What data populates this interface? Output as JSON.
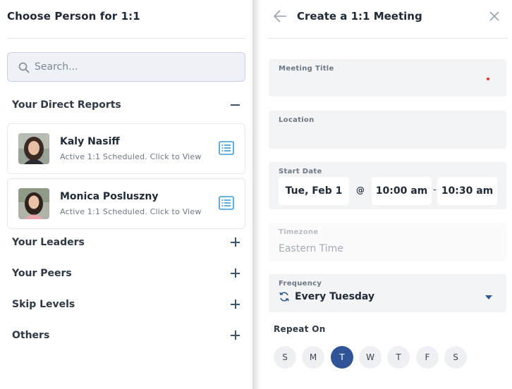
{
  "left": {
    "title": "Choose Person for 1:1",
    "search_placeholder": "Search...",
    "direct_reports_label": "Your Direct Reports",
    "people": [
      {
        "name": "Kaly Nasiff",
        "status": "Active 1:1 Scheduled. Click to View"
      },
      {
        "name": "Monica Posluszny",
        "status": "Active 1:1 Scheduled. Click to View"
      }
    ],
    "sections": [
      "Your Leaders",
      "Your Peers",
      "Skip Levels",
      "Others"
    ]
  },
  "right": {
    "title": "Create a 1:1 Meeting",
    "meeting_title_label": "Meeting Title",
    "location_label": "Location",
    "start_date_label": "Start Date",
    "start_date": "Tue, Feb 1",
    "at": "@",
    "start_time": "10:00 am",
    "dash": "-",
    "end_time": "10:30 am",
    "timezone_label": "Timezone",
    "timezone_value": "Eastern Time",
    "frequency_label": "Frequency",
    "frequency_value": "Every Tuesday",
    "repeat_on_label": "Repeat On",
    "days": [
      {
        "label": "S",
        "active": false
      },
      {
        "label": "M",
        "active": false
      },
      {
        "label": "T",
        "active": true
      },
      {
        "label": "W",
        "active": false
      },
      {
        "label": "T",
        "active": false
      },
      {
        "label": "F",
        "active": false
      },
      {
        "label": "S",
        "active": false
      }
    ]
  },
  "colors": {
    "accent": "#2f5597",
    "list_icon": "#3a9ad9",
    "required": "#e5322e"
  }
}
